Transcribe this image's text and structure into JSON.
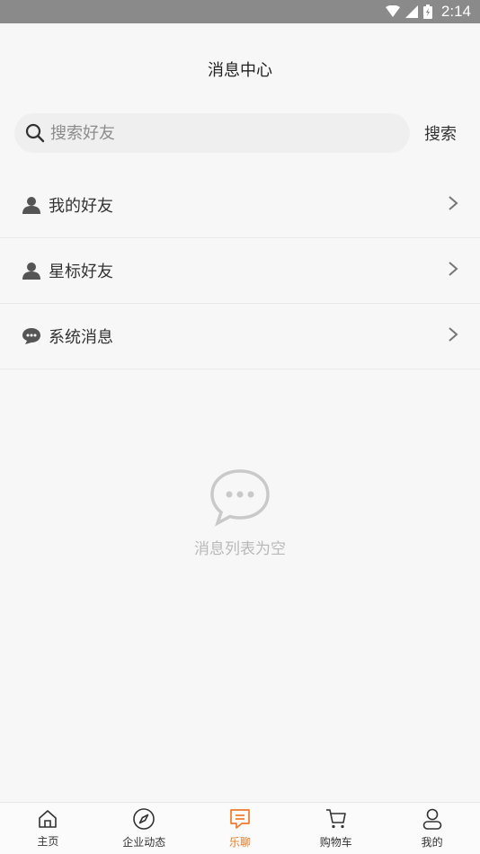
{
  "status_bar": {
    "time": "2:14"
  },
  "header": {
    "title": "消息中心"
  },
  "search": {
    "placeholder": "搜索好友",
    "value": "",
    "button_label": "搜索"
  },
  "menu": [
    {
      "label": "我的好友",
      "icon": "person-icon"
    },
    {
      "label": "星标好友",
      "icon": "person-icon"
    },
    {
      "label": "系统消息",
      "icon": "chat-bubble-icon"
    }
  ],
  "empty_state": {
    "text": "消息列表为空",
    "icon": "chat-bubble-outline-icon"
  },
  "tabbar": {
    "active_color": "#f07b2a",
    "items": [
      {
        "label": "主页",
        "icon": "home-icon"
      },
      {
        "label": "企业动态",
        "icon": "compass-icon"
      },
      {
        "label": "乐聊",
        "icon": "message-icon",
        "active": true
      },
      {
        "label": "购物车",
        "icon": "cart-icon"
      },
      {
        "label": "我的",
        "icon": "user-icon"
      }
    ]
  }
}
